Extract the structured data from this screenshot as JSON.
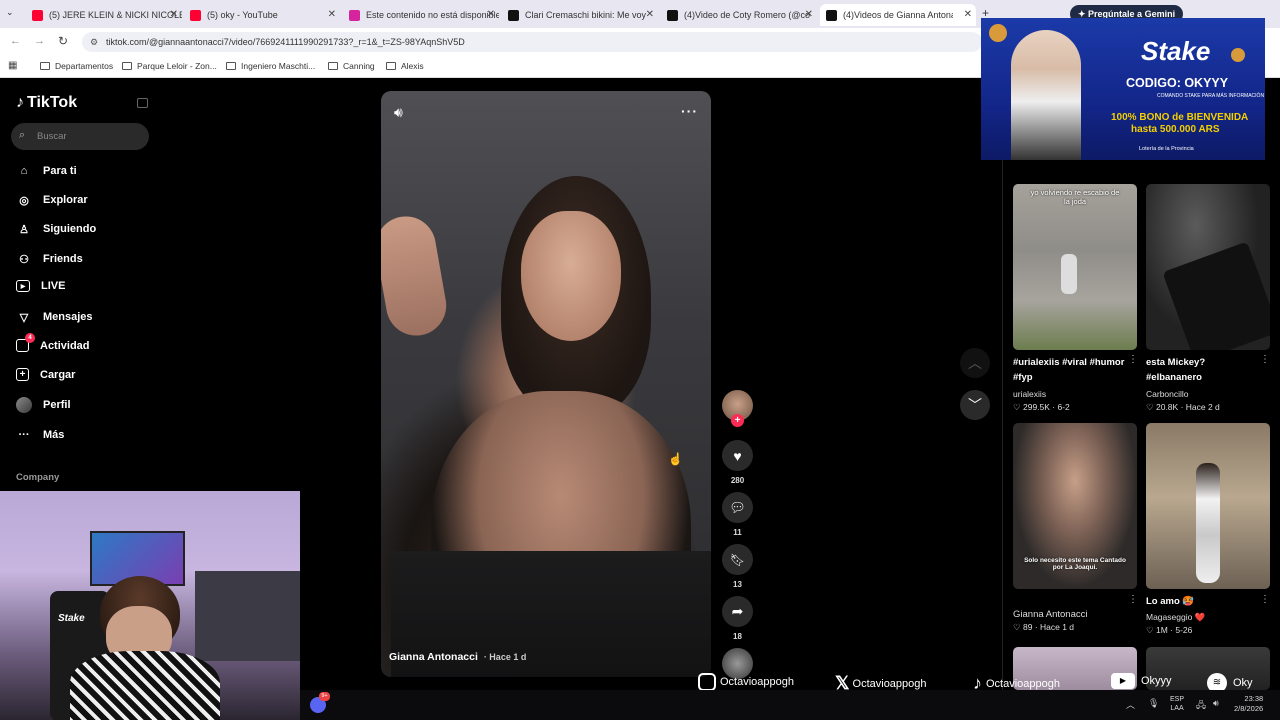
{
  "browser": {
    "tabs": [
      {
        "label": "(5) JERE KLEIN & NICKI NICOLE",
        "color": "#ff0033"
      },
      {
        "label": "(5) oky - YouTube",
        "color": "#ff0033"
      },
      {
        "label": "Este contenido no está disponible",
        "color": "#d6249f"
      },
      {
        "label": "Clari Cremaschi bikini: Me voy",
        "color": "#111111"
      },
      {
        "label": "(4)Video de Coty Romero (@co",
        "color": "#111111"
      },
      {
        "label": "(4)Videos de Gianna Antonacci",
        "color": "#111111"
      }
    ],
    "new_tab": "+",
    "gemini_label": "Pregúntale a Gemini",
    "url": "tiktok.com/@giannaantonacci7/video/7669241111990291733?_r=1&_t=ZS-98YAqnShV5D",
    "bookmarks": [
      "Departamentos",
      "Parque Leloir - Zon...",
      "Ingeniero Maschti...",
      "Canning",
      "Alexis"
    ]
  },
  "tiktok": {
    "logo": "TikTok",
    "search_placeholder": "Buscar",
    "nav": [
      {
        "label": "Para ti",
        "icon": "home-icon"
      },
      {
        "label": "Explorar",
        "icon": "compass-icon"
      },
      {
        "label": "Siguiendo",
        "icon": "following-icon"
      },
      {
        "label": "Friends",
        "icon": "friends-icon"
      },
      {
        "label": "LIVE",
        "icon": "live-icon"
      },
      {
        "label": "Mensajes",
        "icon": "messages-icon"
      },
      {
        "label": "Actividad",
        "icon": "activity-icon",
        "badge": "4"
      },
      {
        "label": "Cargar",
        "icon": "upload-icon"
      },
      {
        "label": "Perfil",
        "icon": "avatar"
      },
      {
        "label": "Más",
        "icon": "more-icon"
      }
    ],
    "company_label": "Company",
    "video": {
      "author": "Gianna Antonacci",
      "time": "· Hace 1 d"
    },
    "actions": {
      "likes": "280",
      "comments": "11",
      "saves": "13",
      "shares": "18"
    },
    "grid": [
      {
        "title": "#urialexiis #viral #humor #fyp",
        "author": "urialexiis",
        "likes": "299.5K",
        "date": "6-2",
        "overlay": "yo volviendo re escabio de la joda"
      },
      {
        "title": "esta Mickey? #elbananero",
        "author": "Carboncillo",
        "likes": "20.8K",
        "date": "Hace 2 d",
        "overlay": ""
      },
      {
        "title": "",
        "author": "Gianna Antonacci",
        "likes": "89",
        "date": "Hace 1 d",
        "overlay": "Solo necesito este tema Cantado por La Joaqui."
      },
      {
        "title": "Lo amo 🥵",
        "author": "Magaseggio ❤️",
        "likes": "1M",
        "date": "5-26",
        "overlay": ""
      }
    ]
  },
  "ad": {
    "brand": "Stake",
    "code": "CODIGO: OKYYY",
    "small": "COMANDO STAKE PARA MÁS INFORMACIÓN",
    "bonus": "100% BONO de BIENVENIDA",
    "bonus2": "hasta 500.000 ARS",
    "lottery": "Lotería de la Provincia"
  },
  "socials": [
    {
      "icon": "instagram-icon",
      "handle": "Octavioappogh"
    },
    {
      "icon": "x-icon",
      "handle": "Octavioappogh"
    },
    {
      "icon": "tiktok-icon",
      "handle": "Octavioappogh"
    },
    {
      "icon": "youtube-icon",
      "handle": "Okyyy"
    },
    {
      "icon": "spotify-icon",
      "handle": "Oky"
    }
  ],
  "taskbar": {
    "lang": "ESP",
    "lang2": "LAA",
    "time": "23:38",
    "date": "2/8/2026",
    "discord_badge": "9+"
  }
}
